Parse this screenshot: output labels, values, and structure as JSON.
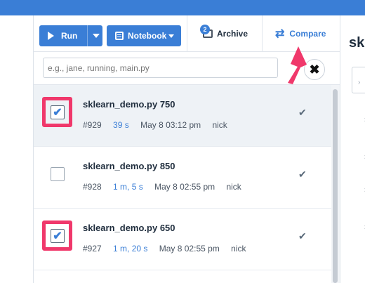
{
  "toolbar": {
    "run_label": "Run",
    "notebook_label": "Notebook",
    "archive_label": "Archive",
    "archive_badge": "2",
    "compare_label": "Compare"
  },
  "search": {
    "placeholder": "e.g., jane, running, main.py",
    "clear_glyph": "✖"
  },
  "runs": [
    {
      "title": "sklearn_demo.py 750",
      "id": "#929",
      "duration": "39 s",
      "time": "May 8 03:12 pm",
      "user": "nick",
      "checked": true
    },
    {
      "title": "sklearn_demo.py 850",
      "id": "#928",
      "duration": "1 m, 5 s",
      "time": "May 8 02:55 pm",
      "user": "nick",
      "checked": false
    },
    {
      "title": "sklearn_demo.py 650",
      "id": "#927",
      "duration": "1 m, 20 s",
      "time": "May 8 02:55 pm",
      "user": "nick",
      "checked": true
    }
  ],
  "right_panel": {
    "title": "sk"
  },
  "colors": {
    "accent": "#3a7ed6",
    "highlight": "#f0386b"
  }
}
